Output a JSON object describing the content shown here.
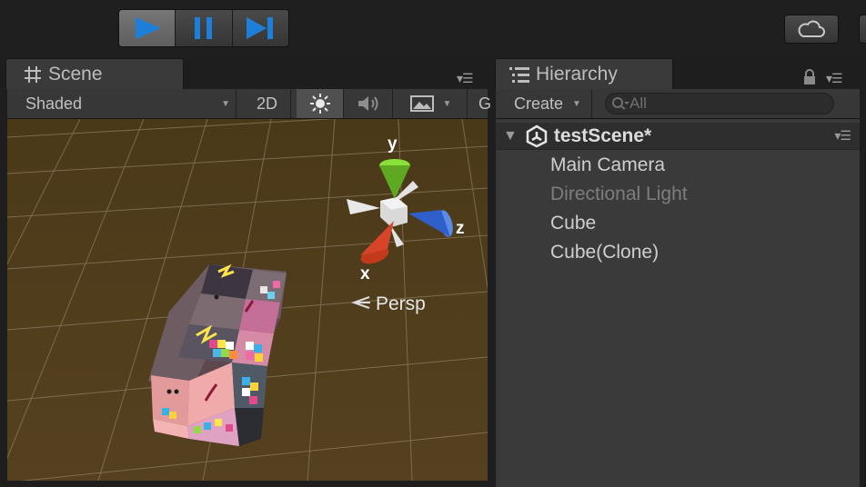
{
  "toolbar": {
    "play_icon": "play-icon",
    "pause_icon": "pause-icon",
    "step_icon": "step-icon",
    "cloud_icon": "cloud-icon",
    "accent_color": "#1e7fd9"
  },
  "scene": {
    "tab_label": "Scene",
    "tab_icon": "grid-icon",
    "shading_mode": "Shaded",
    "mode_2d_label": "2D",
    "partial_label": "G",
    "projection_label": "Persp",
    "gizmo_axes": {
      "x": "x",
      "y": "y",
      "z": "z"
    }
  },
  "hierarchy": {
    "tab_label": "Hierarchy",
    "tab_icon": "list-icon",
    "create_label": "Create",
    "search_placeholder": "All",
    "scene_name": "testScene*",
    "items": [
      {
        "label": "Main Camera",
        "enabled": true
      },
      {
        "label": "Directional Light",
        "enabled": false
      },
      {
        "label": "Cube",
        "enabled": true
      },
      {
        "label": "Cube(Clone)",
        "enabled": true
      }
    ]
  }
}
